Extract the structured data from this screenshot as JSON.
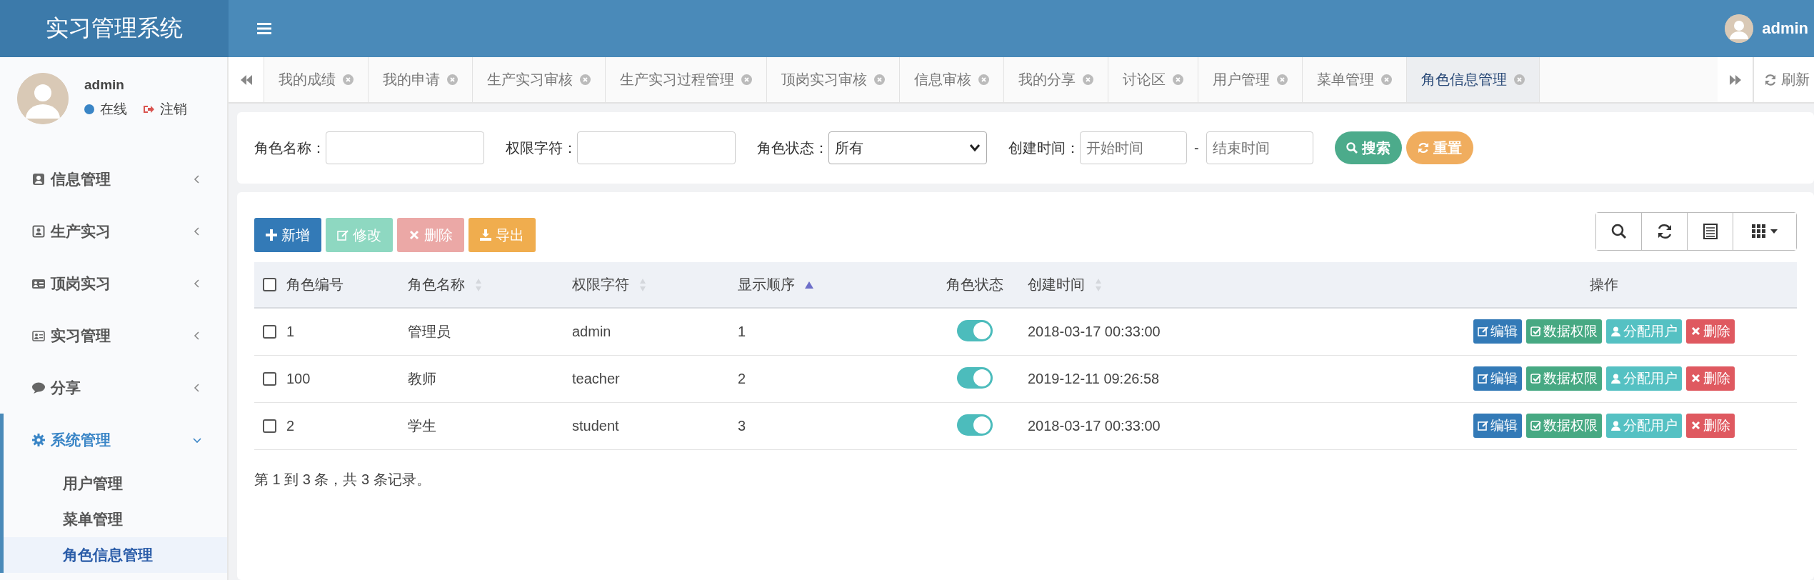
{
  "header": {
    "title": "实习管理系统",
    "user": "admin"
  },
  "sidebar": {
    "user": {
      "name": "admin",
      "status": "在线",
      "logout": "注销"
    },
    "items": [
      {
        "label": "信息管理",
        "kind": "contact",
        "expanded": false,
        "selected": false
      },
      {
        "label": "生产实习",
        "kind": "badge",
        "expanded": false,
        "selected": false
      },
      {
        "label": "顶岗实习",
        "kind": "card",
        "expanded": false,
        "selected": false
      },
      {
        "label": "实习管理",
        "kind": "card-outline",
        "expanded": false,
        "selected": false
      },
      {
        "label": "分享",
        "kind": "comment",
        "expanded": false,
        "selected": false
      },
      {
        "label": "系统管理",
        "kind": "gear",
        "expanded": true,
        "selected": true,
        "children": [
          {
            "label": "用户管理",
            "selected": false
          },
          {
            "label": "菜单管理",
            "selected": false
          },
          {
            "label": "角色信息管理",
            "selected": true
          }
        ]
      }
    ]
  },
  "tabs": [
    {
      "label": "我的成绩",
      "selected": false
    },
    {
      "label": "我的申请",
      "selected": false
    },
    {
      "label": "生产实习审核",
      "selected": false
    },
    {
      "label": "生产实习过程管理",
      "selected": false
    },
    {
      "label": "顶岗实习审核",
      "selected": false
    },
    {
      "label": "信息审核",
      "selected": false
    },
    {
      "label": "我的分享",
      "selected": false
    },
    {
      "label": "讨论区",
      "selected": false
    },
    {
      "label": "用户管理",
      "selected": false
    },
    {
      "label": "菜单管理",
      "selected": false
    },
    {
      "label": "角色信息管理",
      "selected": true
    }
  ],
  "refresh": "刷新",
  "search": {
    "fields": [
      {
        "kind": "text",
        "label": "角色名称："
      },
      {
        "kind": "text",
        "label": "权限字符："
      },
      {
        "kind": "select",
        "label": "角色状态：",
        "value": "所有"
      },
      {
        "kind": "daterange",
        "label": "创建时间：",
        "start_placeholder": "开始时间",
        "separator": "-",
        "end_placeholder": "结束时间"
      }
    ],
    "buttons": [
      {
        "kind": "search",
        "label": "搜索"
      },
      {
        "kind": "reset",
        "label": "重置"
      }
    ]
  },
  "toolbar": [
    {
      "kind": "add",
      "label": "新增",
      "disabled": false
    },
    {
      "kind": "edit",
      "label": "修改",
      "disabled": true
    },
    {
      "kind": "remove",
      "label": "删除",
      "disabled": true
    },
    {
      "kind": "export",
      "label": "导出",
      "disabled": false
    }
  ],
  "table": {
    "all_checked": false,
    "columns": [
      {
        "label": "角色编号",
        "sortable": false,
        "sorted": false
      },
      {
        "label": "角色名称",
        "sortable": true,
        "sorted": false
      },
      {
        "label": "权限字符",
        "sortable": true,
        "sorted": false
      },
      {
        "label": "显示顺序",
        "sortable": true,
        "sorted": true
      },
      {
        "label": "角色状态",
        "sortable": false,
        "sorted": false
      },
      {
        "label": "创建时间",
        "sortable": true,
        "sorted": false
      },
      {
        "label": "操作",
        "sortable": false,
        "sorted": false
      }
    ],
    "rows": [
      {
        "checked": false,
        "cells": [
          "1",
          "管理员",
          "admin",
          "1"
        ],
        "on": true,
        "created": "2018-03-17 00:33:00",
        "actions": [
          {
            "kind": "edit",
            "label": "编辑"
          },
          {
            "kind": "data",
            "label": "数据权限"
          },
          {
            "kind": "assign",
            "label": "分配用户"
          },
          {
            "kind": "remove",
            "label": "删除"
          }
        ]
      },
      {
        "checked": false,
        "cells": [
          "100",
          "教师",
          "teacher",
          "2"
        ],
        "on": true,
        "created": "2019-12-11 09:26:58",
        "actions": [
          {
            "kind": "edit",
            "label": "编辑"
          },
          {
            "kind": "data",
            "label": "数据权限"
          },
          {
            "kind": "assign",
            "label": "分配用户"
          },
          {
            "kind": "remove",
            "label": "删除"
          }
        ]
      },
      {
        "checked": false,
        "cells": [
          "2",
          "学生",
          "student",
          "3"
        ],
        "on": true,
        "created": "2018-03-17 00:33:00",
        "actions": [
          {
            "kind": "edit",
            "label": "编辑"
          },
          {
            "kind": "data",
            "label": "数据权限"
          },
          {
            "kind": "assign",
            "label": "分配用户"
          },
          {
            "kind": "remove",
            "label": "删除"
          }
        ]
      }
    ]
  },
  "footer": "第 1 到 3 条，共 3 条记录。"
}
